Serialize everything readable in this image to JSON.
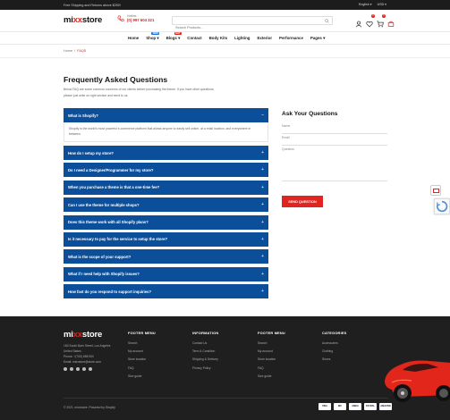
{
  "topbar": {
    "promo": "Free Shipping and Returns above $250!",
    "language": "English",
    "currency": "USD"
  },
  "header": {
    "logo_left": "mi",
    "logo_xx": "xx",
    "logo_right": "store",
    "hotline_label": "Hotline",
    "hotline_number": "(0) 997 604 321",
    "search_placeholder": "Search Products...",
    "compare_count": "0",
    "cart_count": "0",
    "icons": [
      "user-icon",
      "heart-icon",
      "cart-icon",
      "compare-icon"
    ]
  },
  "nav": {
    "items": [
      {
        "label": "Home",
        "arrow": ""
      },
      {
        "label": "Shop",
        "arrow": "▾",
        "tag": "NEW",
        "tag_color": "#1a73e8"
      },
      {
        "label": "Blogs",
        "arrow": "▾",
        "tag": "HOT",
        "tag_color": "#e0241f"
      },
      {
        "label": "Contact",
        "arrow": ""
      },
      {
        "label": "Body Kits",
        "arrow": ""
      },
      {
        "label": "Lighting",
        "arrow": ""
      },
      {
        "label": "Exterior",
        "arrow": ""
      },
      {
        "label": "Performance",
        "arrow": ""
      },
      {
        "label": "Pages",
        "arrow": "▾"
      }
    ]
  },
  "breadcrumb": {
    "home": "Home",
    "sep": "/",
    "current": "FAQS"
  },
  "faq": {
    "title": "Frequently Asked Questions",
    "intro_line1": "Below FAQ are some common concerns of our clients before purchasing the theme. If you have other questions,",
    "intro_line2": "please just write on right section and send to us.",
    "questions": [
      {
        "q": "What is Shopify?",
        "icon": "–",
        "answer": "Shopify is the world's most powerful e-commerce platform that allows anyone to easily sell online, at a retail location, and everywhere in between."
      },
      {
        "q": "How do I setup my store?",
        "icon": "+"
      },
      {
        "q": "Do I need a Designer/Programmer for my store?",
        "icon": "+"
      },
      {
        "q": "When you purchase a theme is that a one-time fee?",
        "icon": "+"
      },
      {
        "q": "Can I use the theme for multiple shops?",
        "icon": "+"
      },
      {
        "q": "Does this theme work with all Shopify plans?",
        "icon": "+"
      },
      {
        "q": "Is it necessary to pay for the service to setup the store?",
        "icon": "+"
      },
      {
        "q": "What is the scope of your support?",
        "icon": "+"
      },
      {
        "q": "What if I need help with Shopify issues?",
        "icon": "+"
      },
      {
        "q": "How fast do you respond to support inquiries?",
        "icon": "+"
      }
    ]
  },
  "ask": {
    "title": "Ask Your Questions",
    "name_placeholder": "Name",
    "email_placeholder": "Email",
    "question_placeholder": "Question",
    "send_label": "SEND QUESTION"
  },
  "footer": {
    "logo_left": "mi",
    "logo_xx": "xx",
    "logo_right": "store",
    "address_lines": [
      "163 South Barn Street, Los Angeles",
      "United States",
      "Phone: +(700) 658 900",
      "Email: mixxstore@store.com"
    ],
    "columns": [
      {
        "title": "FOOTER MENU",
        "links": [
          "Search",
          "My account",
          "Store location",
          "FAQ",
          "Size guide"
        ]
      },
      {
        "title": "INFORMATION",
        "links": [
          "Contact Us",
          "Term & Condition",
          "Shipping & Delivery",
          "Privacy Policy"
        ]
      },
      {
        "title": "FOOTER MENU",
        "links": [
          "Search",
          "My account",
          "Store location",
          "FAQ",
          "Size guide"
        ]
      },
      {
        "title": "CATEGORIES",
        "links": [
          "Accessories",
          "Clothing",
          "Shoes"
        ]
      }
    ],
    "copyright": "© 2021, mixxstore. Powered by Shopify",
    "payments": [
      "VISA",
      "MC",
      "AMEX",
      "PAYPAL",
      "AMAZON"
    ]
  }
}
